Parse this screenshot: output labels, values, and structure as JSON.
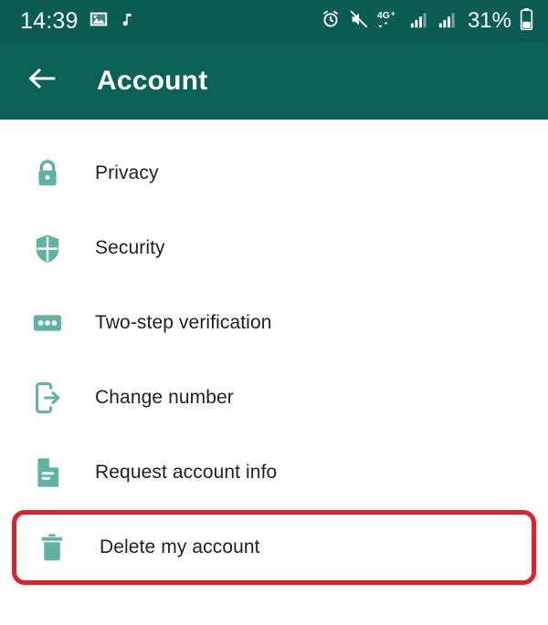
{
  "status_bar": {
    "time": "14:39",
    "battery_percent": "31%",
    "left_icons": [
      "image-icon",
      "music-note-icon"
    ],
    "right_icons": [
      "alarm-icon",
      "mute-icon",
      "mobile-data-4g-plus-icon",
      "signal-bars-sim1-icon",
      "signal-bars-sim2-icon"
    ],
    "network_label": "4G+",
    "background_color": "#0b5d52"
  },
  "app_bar": {
    "title": "Account",
    "back_icon": "arrow-left-icon",
    "background_color": "#0a6157"
  },
  "settings": {
    "items": [
      {
        "label": "Privacy",
        "icon": "lock-icon"
      },
      {
        "label": "Security",
        "icon": "shield-icon"
      },
      {
        "label": "Two-step verification",
        "icon": "password-dots-icon"
      },
      {
        "label": "Change number",
        "icon": "phone-exit-arrow-icon"
      },
      {
        "label": "Request account info",
        "icon": "document-icon"
      },
      {
        "label": "Delete my account",
        "icon": "trash-icon"
      }
    ],
    "icon_color": "#5fb3a1",
    "highlight": {
      "target_label": "Delete my account",
      "border_color": "#de2229"
    }
  }
}
